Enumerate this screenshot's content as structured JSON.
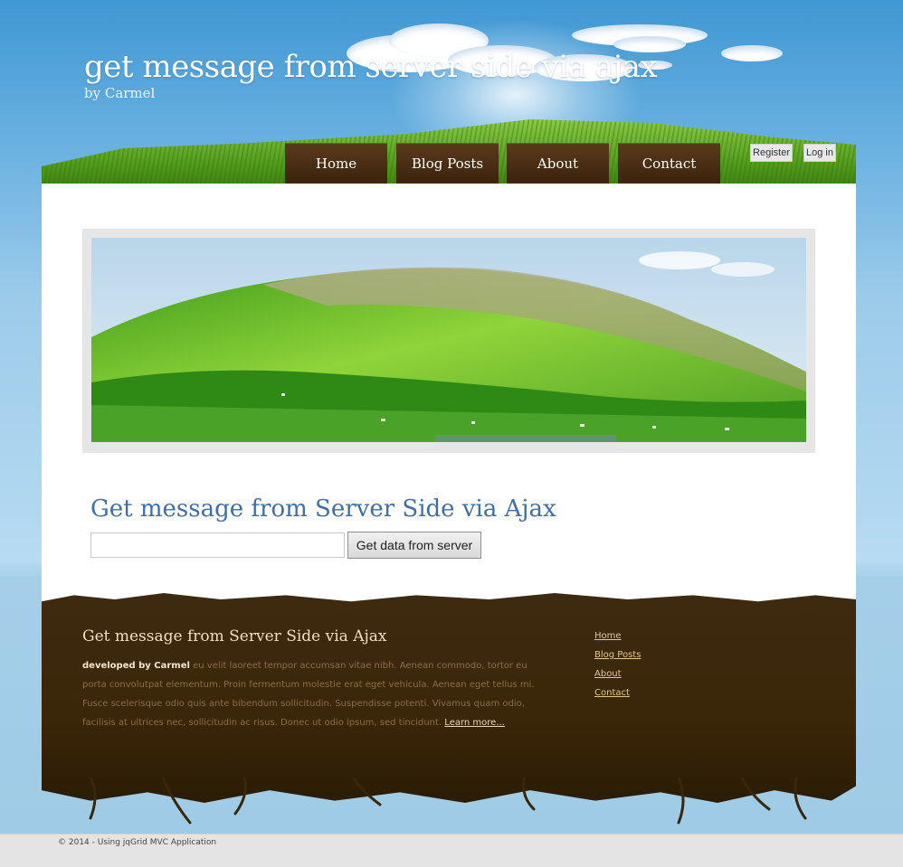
{
  "header": {
    "title": "get message from server side via ajax",
    "subtitle": "by Carmel"
  },
  "nav": {
    "items": [
      {
        "label": "Home"
      },
      {
        "label": "Blog Posts"
      },
      {
        "label": "About"
      },
      {
        "label": "Contact"
      }
    ]
  },
  "account": {
    "register_label": "Register",
    "login_label": "Log in"
  },
  "main": {
    "heading": "Get message from Server Side via Ajax",
    "input_value": "",
    "button_label": "Get data from server"
  },
  "footer": {
    "title": "Get message from Server Side via Ajax",
    "developed_by": "developed by Carmel",
    "body_text": " eu velit laoreet tempor accumsan vitae nibh. Aenean commodo, tortor eu porta convolutpat elementum. Proin fermentum molestie erat eget vehicula. Aenean eget tellus mi. Fusce scelerisque odio quis ante bibendum sollicitudin. Suspendisse potenti. Vivamus quam odio, facilisis at ultrices nec, sollicitudin ac risus. Donec ut odio ipsum, sed tincidunt. ",
    "more_label": "Learn more...",
    "links": [
      {
        "label": "Home"
      },
      {
        "label": "Blog Posts"
      },
      {
        "label": "About"
      },
      {
        "label": "Contact"
      }
    ]
  },
  "copyright": "© 2014 - Using jqGrid MVC Application",
  "colors": {
    "sky": "#3f97d3",
    "nav_brown": "#4a2e14",
    "heading_blue": "#3f6fa6",
    "footer_brown": "#3a2608"
  }
}
